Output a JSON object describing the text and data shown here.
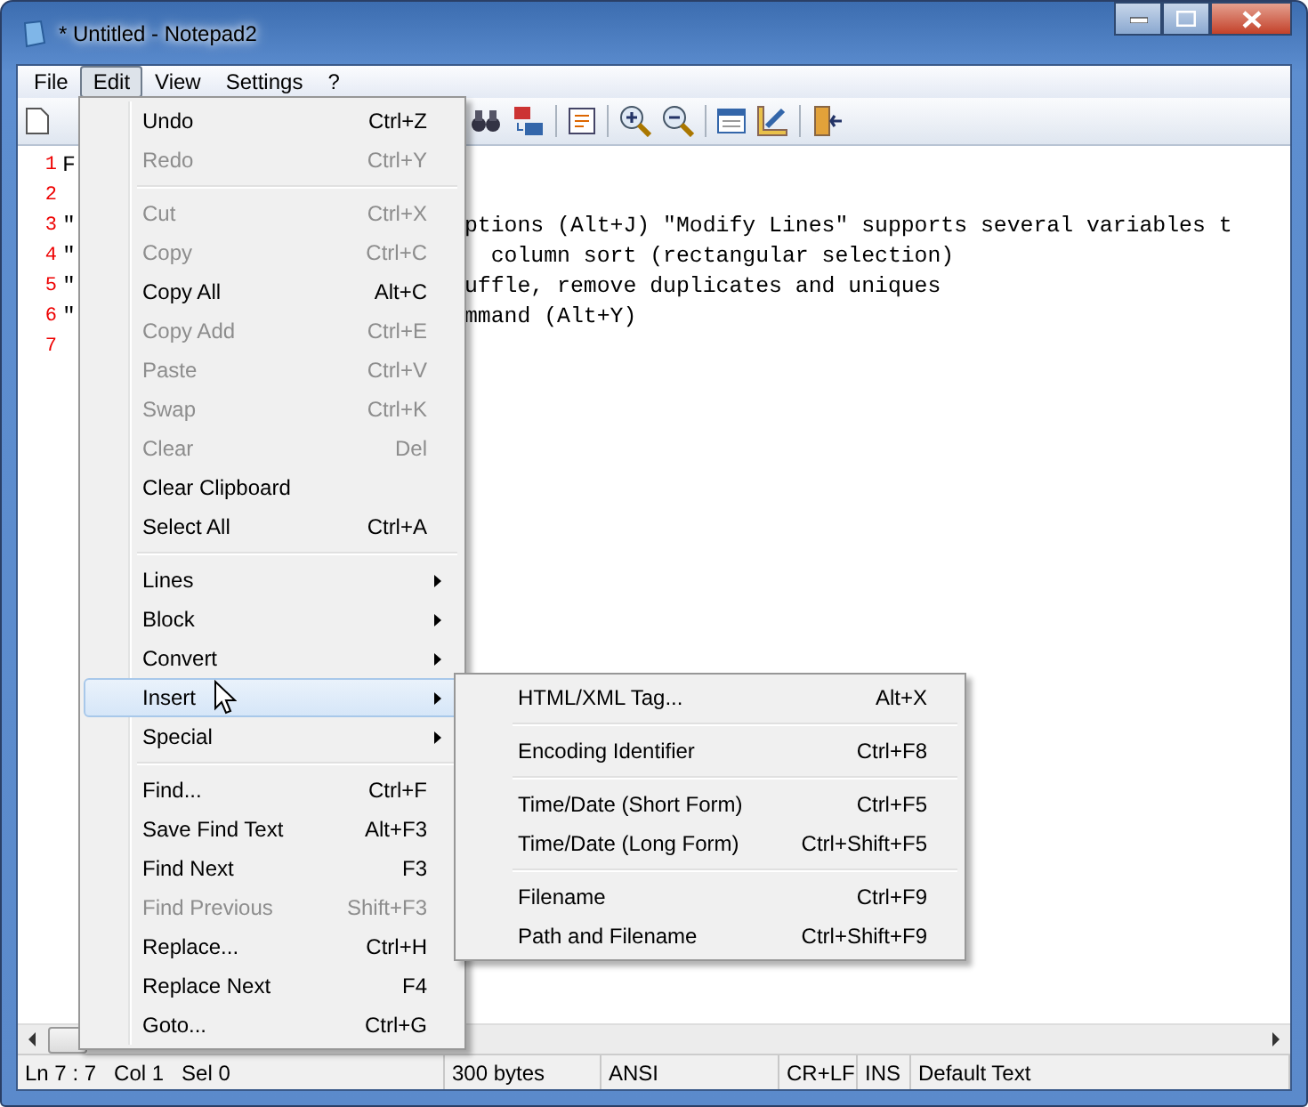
{
  "window": {
    "title": "* Untitled - Notepad2"
  },
  "menubar": [
    {
      "label": "File",
      "selected": false
    },
    {
      "label": "Edit",
      "selected": true
    },
    {
      "label": "View",
      "selected": false
    },
    {
      "label": "Settings",
      "selected": false
    },
    {
      "label": "?",
      "selected": false
    }
  ],
  "editor": {
    "lines": [
      {
        "number": "1",
        "start": "F"
      },
      {
        "number": "2"
      },
      {
        "number": "3",
        "start": "\"",
        "rest": "ptions (Alt+J) \"Modify Lines\" supports several variables t"
      },
      {
        "number": "4",
        "start": "\"",
        "rest": "  column sort (rectangular selection)"
      },
      {
        "number": "5",
        "start": "\"",
        "rest": "uffle, remove duplicates and uniques"
      },
      {
        "number": "6",
        "start": "\"",
        "rest": "mmand (Alt+Y)"
      },
      {
        "number": "7"
      }
    ]
  },
  "edit_menu": [
    {
      "kind": "item",
      "label": "Undo",
      "shortcut": "Ctrl+Z",
      "disabled": false
    },
    {
      "kind": "item",
      "label": "Redo",
      "shortcut": "Ctrl+Y",
      "disabled": true
    },
    {
      "kind": "separator"
    },
    {
      "kind": "item",
      "label": "Cut",
      "shortcut": "Ctrl+X",
      "disabled": true
    },
    {
      "kind": "item",
      "label": "Copy",
      "shortcut": "Ctrl+C",
      "disabled": true
    },
    {
      "kind": "item",
      "label": "Copy All",
      "shortcut": "Alt+C",
      "disabled": false
    },
    {
      "kind": "item",
      "label": "Copy Add",
      "shortcut": "Ctrl+E",
      "disabled": true
    },
    {
      "kind": "item",
      "label": "Paste",
      "shortcut": "Ctrl+V",
      "disabled": true
    },
    {
      "kind": "item",
      "label": "Swap",
      "shortcut": "Ctrl+K",
      "disabled": true
    },
    {
      "kind": "item",
      "label": "Clear",
      "shortcut": "Del",
      "disabled": true
    },
    {
      "kind": "item",
      "label": "Clear Clipboard",
      "disabled": false
    },
    {
      "kind": "item",
      "label": "Select All",
      "shortcut": "Ctrl+A",
      "disabled": false
    },
    {
      "kind": "separator"
    },
    {
      "kind": "submenu",
      "label": "Lines",
      "selected": false
    },
    {
      "kind": "submenu",
      "label": "Block",
      "selected": false
    },
    {
      "kind": "submenu",
      "label": "Convert",
      "selected": false
    },
    {
      "kind": "submenu",
      "label": "Insert",
      "selected": true
    },
    {
      "kind": "submenu",
      "label": "Special",
      "selected": false
    },
    {
      "kind": "separator"
    },
    {
      "kind": "item",
      "label": "Find...",
      "shortcut": "Ctrl+F",
      "disabled": false
    },
    {
      "kind": "item",
      "label": "Save Find Text",
      "shortcut": "Alt+F3",
      "disabled": false
    },
    {
      "kind": "item",
      "label": "Find Next",
      "shortcut": "F3",
      "disabled": false
    },
    {
      "kind": "item",
      "label": "Find Previous",
      "shortcut": "Shift+F3",
      "disabled": true
    },
    {
      "kind": "item",
      "label": "Replace...",
      "shortcut": "Ctrl+H",
      "disabled": false
    },
    {
      "kind": "item",
      "label": "Replace Next",
      "shortcut": "F4",
      "disabled": false
    },
    {
      "kind": "item",
      "label": "Goto...",
      "shortcut": "Ctrl+G",
      "disabled": false
    }
  ],
  "insert_submenu": [
    {
      "kind": "item",
      "label": "HTML/XML Tag...",
      "shortcut": "Alt+X",
      "disabled": false
    },
    {
      "kind": "separator"
    },
    {
      "kind": "item",
      "label": "Encoding Identifier",
      "shortcut": "Ctrl+F8",
      "disabled": false
    },
    {
      "kind": "separator"
    },
    {
      "kind": "item",
      "label": "Time/Date (Short Form)",
      "shortcut": "Ctrl+F5",
      "disabled": false
    },
    {
      "kind": "item",
      "label": "Time/Date (Long Form)",
      "shortcut": "Ctrl+Shift+F5",
      "disabled": false
    },
    {
      "kind": "separator"
    },
    {
      "kind": "item",
      "label": "Filename",
      "shortcut": "Ctrl+F9",
      "disabled": false
    },
    {
      "kind": "item",
      "label": "Path and Filename",
      "shortcut": "Ctrl+Shift+F9",
      "disabled": false
    }
  ],
  "status_bar": [
    "Ln 7 : 7   Col 1   Sel 0",
    "300 bytes",
    "ANSI",
    "CR+LF",
    "INS",
    "Default Text"
  ]
}
